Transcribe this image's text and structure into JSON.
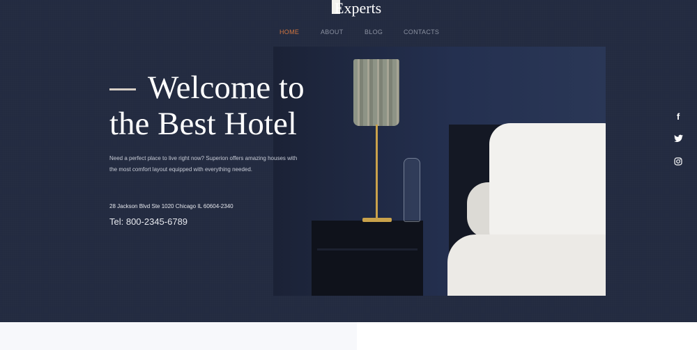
{
  "brand": {
    "name": "Experts"
  },
  "nav": {
    "items": [
      "HOME",
      "ABOUT",
      "BLOG",
      "CONTACTS"
    ],
    "active": "HOME"
  },
  "hero": {
    "title_line1": "Welcome to",
    "title_line2": "the Best Hotel",
    "description": "Need a perfect place to live right now? Superion offers amazing houses with the most comfort layout equipped with everything needed.",
    "address": "28 Jackson Blvd Ste 1020 Chicago IL 60604-2340",
    "phone": "Tel: 800-2345-6789"
  },
  "social": [
    {
      "name": "facebook",
      "icon": "facebook-icon",
      "glyph": "f"
    },
    {
      "name": "twitter",
      "icon": "twitter-icon",
      "glyph": "🐦"
    },
    {
      "name": "instagram",
      "icon": "instagram-icon",
      "glyph": "◎"
    }
  ],
  "colors": {
    "background": "#232b40",
    "accent": "#d0753f",
    "text": "#ffffff"
  }
}
